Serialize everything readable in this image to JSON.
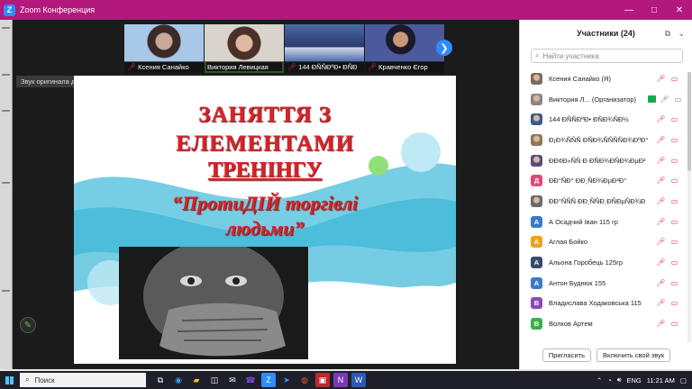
{
  "window": {
    "title": "Zoom Конференция",
    "controls": [
      "—",
      "□",
      "✕"
    ]
  },
  "video": {
    "thumbnails": [
      {
        "name": "Ксения Санайко",
        "muted": true,
        "bg": "#6e6a78"
      },
      {
        "name": "Виктория Левицкая",
        "muted": false,
        "active": true,
        "bg": "#8a8680"
      },
      {
        "name": "144 ÐÑÑÐºÐ• ÐÑÐ",
        "muted": true,
        "bg": "#3a5a8c"
      },
      {
        "name": "Кравченко Єгор",
        "muted": true,
        "bg": "#2a3a5c"
      }
    ],
    "next_arrow": "❯",
    "tooltip": "Звук оригинала для музыкантов выключен",
    "slide": {
      "line1": "ЗАНЯТТЯ З",
      "line2": "ЕЛЕМЕНТАМИ",
      "line3": "ТРЕНІНГУ",
      "line4": "“ПротиДІЙ торгівлі",
      "line5": "людьми”"
    }
  },
  "panel": {
    "title": "Участники (24)",
    "search_placeholder": "Найти участника",
    "participants": [
      {
        "initial": "",
        "name": "Ксения Санайко (Я)",
        "color": "#7a6a60",
        "photo": true,
        "mic_muted": true,
        "cam_off": true
      },
      {
        "initial": "",
        "name": "Виктория Л... (Организатор)",
        "color": "#8a8680",
        "photo": true,
        "mic_muted": false,
        "cam_off": false,
        "host": true
      },
      {
        "initial": "",
        "name": "144 ÐÑÑÐºÐ• ÐÑÐ¾ÑÐ½",
        "color": "#3a5a8c",
        "photo": true,
        "mic_muted": true,
        "cam_off": true
      },
      {
        "initial": "",
        "name": "Ð¡Ð¾ÑÑÑ ÐÑÐ¾ÑÑÑÑÐ¾ÐºÐ°",
        "color": "#8a7a5a",
        "photo": true,
        "mic_muted": true,
        "cam_off": true
      },
      {
        "initial": "",
        "name": "ÐÐ¢Ð»ÑÑ Ð ÐÑÐ¾ÐÑÐ¾ÐµÐ²",
        "color": "#5a4a7a",
        "photo": true,
        "mic_muted": true,
        "cam_off": true
      },
      {
        "initial": "Д",
        "name": "ÐÐ°ÑÐ° ÐÐ¸ÑÐ¾ÐµÐ²Ð°",
        "color": "#e04a7a",
        "photo": false,
        "mic_muted": true,
        "cam_off": true
      },
      {
        "initial": "",
        "name": "ÐÐ°ÑÑÑ ÐÐ¸ÑÑÐ¸ÐÑÐµÑÐ¾Ð",
        "color": "#6a6a6a",
        "photo": true,
        "mic_muted": true,
        "cam_off": true
      },
      {
        "initial": "А",
        "name": "А Осадчий Іван 115 гр",
        "color": "#3a7ac8",
        "photo": false,
        "mic_muted": true,
        "cam_off": true
      },
      {
        "initial": "А",
        "name": "Аглая Бойко",
        "color": "#f0a020",
        "photo": false,
        "mic_muted": true,
        "cam_off": true
      },
      {
        "initial": "А",
        "name": "Альона Горобець 125гр",
        "color": "#3a4a6a",
        "photo": false,
        "mic_muted": true,
        "cam_off": true
      },
      {
        "initial": "А",
        "name": "Антон Буднюк 155",
        "color": "#3a7ac8",
        "photo": false,
        "mic_muted": true,
        "cam_off": true
      },
      {
        "initial": "В",
        "name": "Владислава Ходаковська 115",
        "color": "#8a4ab8",
        "photo": false,
        "mic_muted": true,
        "cam_off": true
      },
      {
        "initial": "В",
        "name": "Волков Артем",
        "color": "#3ab04a",
        "photo": false,
        "mic_muted": true,
        "cam_off": true
      }
    ],
    "invite_label": "Пригласить",
    "unmute_label": "Включить свой звук"
  },
  "taskbar": {
    "search_label": "Поиск",
    "lang": "ENG",
    "time": "11:21 AM"
  }
}
